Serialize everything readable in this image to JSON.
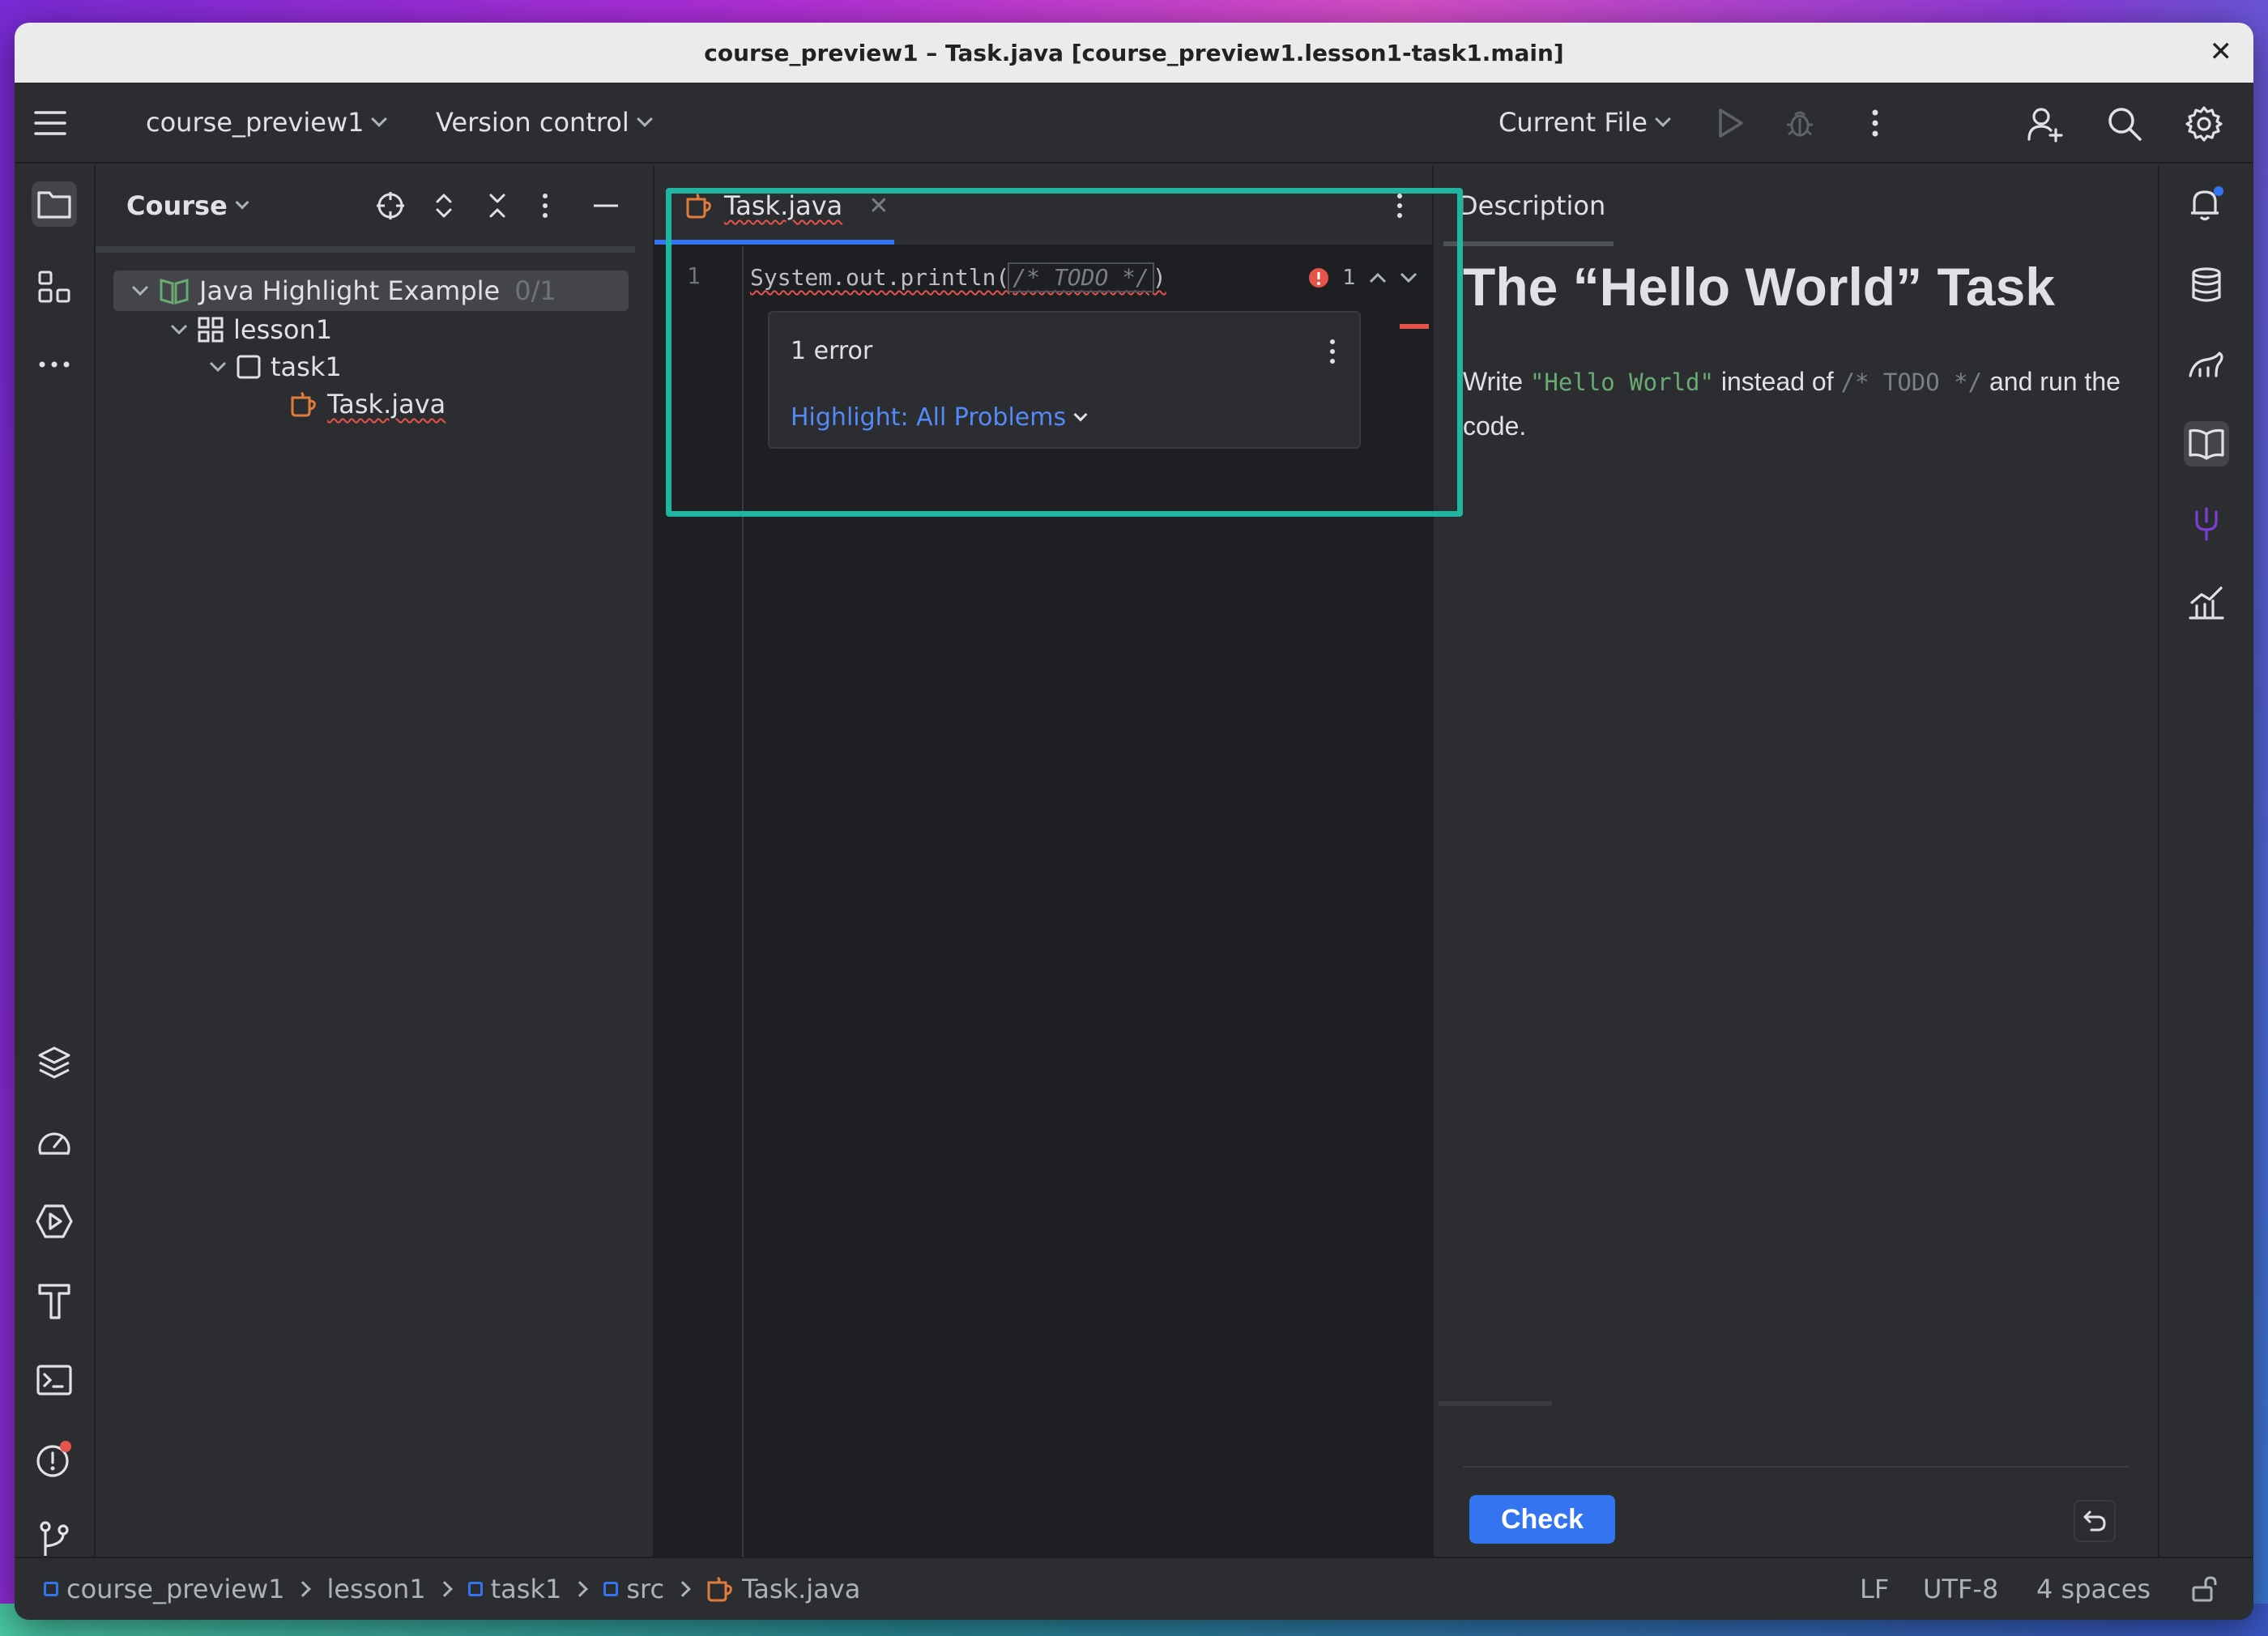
{
  "window": {
    "title": "course_preview1 – Task.java [course_preview1.lesson1-task1.main]",
    "close_glyph": "✕"
  },
  "toolbar": {
    "project_name": "course_preview1",
    "vcs_label": "Version control",
    "run_config": "Current File"
  },
  "project_panel": {
    "title": "Course",
    "tree": {
      "root_label": "Java Highlight Example",
      "root_progress": "0/1",
      "lesson_label": "lesson1",
      "task_label": "task1",
      "file_label": "Task.java"
    }
  },
  "editor": {
    "tab_label": "Task.java",
    "line_number": "1",
    "code_prefix": "System.out.println(",
    "code_comment": "/* TODO */",
    "code_suffix": ")",
    "error_count": "1",
    "popup": {
      "title": "1 error",
      "highlight_link": "Highlight: All Problems"
    }
  },
  "description": {
    "header": "Description",
    "title": "The “Hello World” Task",
    "text_write": "Write",
    "text_code": "\"Hello World\"",
    "text_instead": "instead of",
    "text_todo": "/* TODO */",
    "text_run": "and run the code.",
    "check_label": "Check"
  },
  "statusbar": {
    "crumbs": [
      "course_preview1",
      "lesson1",
      "task1",
      "src",
      "Task.java"
    ],
    "line_sep": "LF",
    "encoding": "UTF-8",
    "indent": "4 spaces"
  },
  "colors": {
    "accent": "#3574f0",
    "highlight_border": "#1fb5a0",
    "error": "#e5534b"
  }
}
